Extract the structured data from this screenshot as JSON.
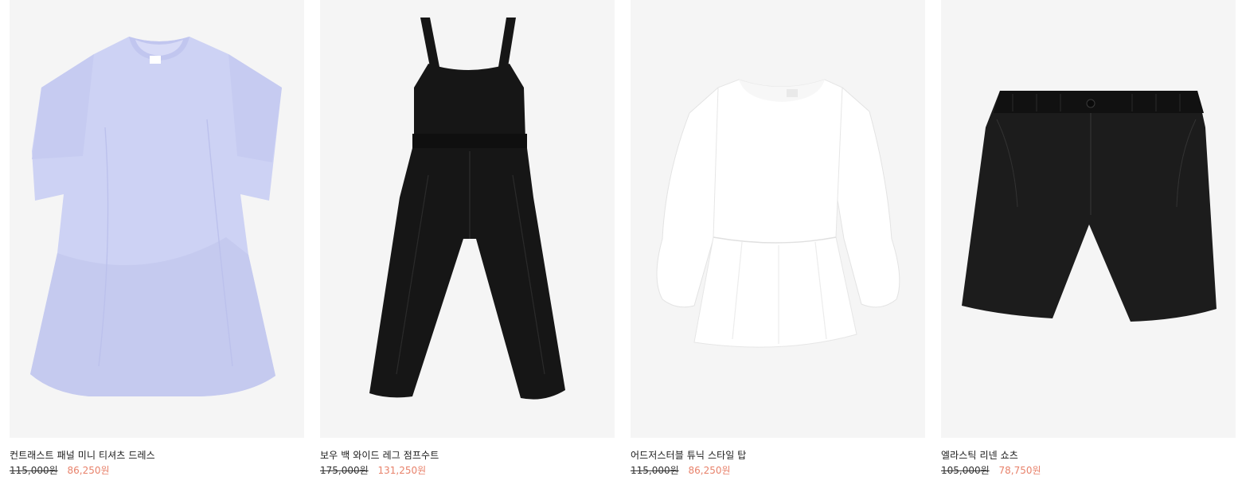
{
  "colors": {
    "image_background": "#f5f5f5",
    "sale_price": "#e8826b",
    "original_price": "#333333",
    "text": "#1a1a1a"
  },
  "products": [
    {
      "name": "컨트래스트 패널 미니 티셔츠 드레스",
      "original_price": "115,000원",
      "sale_price": "86,250원",
      "image_icon": "lavender-tshirt-dress-image",
      "color": "#cfd3f5"
    },
    {
      "name": "보우 백 와이드 레그 점프수트",
      "original_price": "175,000원",
      "sale_price": "131,250원",
      "image_icon": "black-wide-leg-jumpsuit-image",
      "color": "#161616"
    },
    {
      "name": "어드저스터블 튜닉 스타일 탑",
      "original_price": "115,000원",
      "sale_price": "86,250원",
      "image_icon": "white-tunic-top-image",
      "color": "#ffffff"
    },
    {
      "name": "엘라스틱 리넨 쇼츠",
      "original_price": "105,000원",
      "sale_price": "78,750원",
      "image_icon": "black-linen-shorts-image",
      "color": "#1c1c1c"
    }
  ]
}
